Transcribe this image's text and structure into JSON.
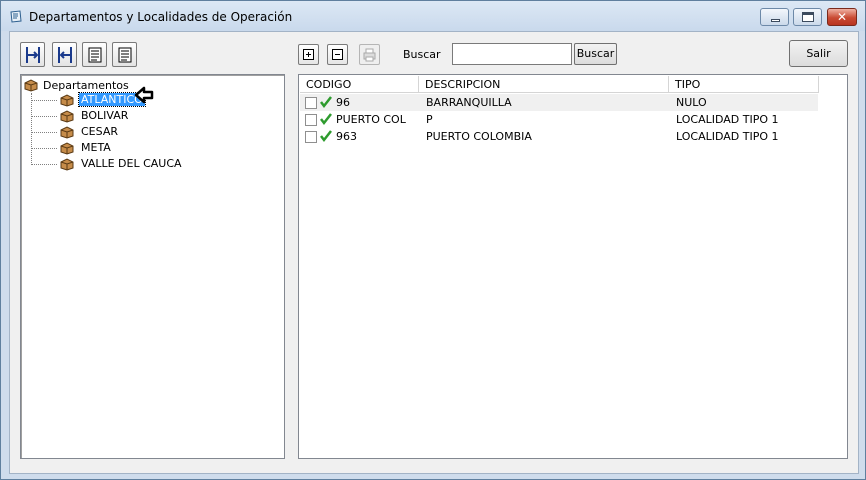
{
  "window": {
    "title": "Departamentos y Localidades de Operación",
    "close_glyph": "✕"
  },
  "left_toolbar": [
    {
      "icon": "expand-tree-icon"
    },
    {
      "icon": "collapse-tree-icon"
    },
    {
      "icon": "report-icon"
    },
    {
      "icon": "report-detail-icon"
    }
  ],
  "tree": {
    "root_label": "Departamentos",
    "items": [
      {
        "label": "ATLANTICO",
        "selected": true
      },
      {
        "label": "BOLIVAR"
      },
      {
        "label": "CESAR"
      },
      {
        "label": "META"
      },
      {
        "label": "VALLE DEL CAUCA"
      }
    ]
  },
  "right_toolbar": {
    "add_icon": "plus-box-icon",
    "remove_icon": "minus-box-icon",
    "print_icon": "printer-icon",
    "search_label": "Buscar",
    "search_value": "",
    "search_button": "Buscar",
    "exit_button": "Salir"
  },
  "grid": {
    "columns": [
      "CODIGO",
      "DESCRIPCION",
      "TIPO"
    ],
    "rows": [
      {
        "checked": false,
        "active": true,
        "codigo": "96",
        "descripcion": "BARRANQUILLA",
        "tipo": "NULO"
      },
      {
        "checked": false,
        "active": true,
        "codigo": "PUERTO COL",
        "descripcion": "P",
        "tipo": "LOCALIDAD TIPO 1"
      },
      {
        "checked": false,
        "active": true,
        "codigo": "963",
        "descripcion": "PUERTO COLOMBIA",
        "tipo": "LOCALIDAD TIPO 1"
      }
    ]
  },
  "colors": {
    "selection": "#3399ff",
    "check_green": "#2e9b2e",
    "close_red": "#c94a33"
  }
}
